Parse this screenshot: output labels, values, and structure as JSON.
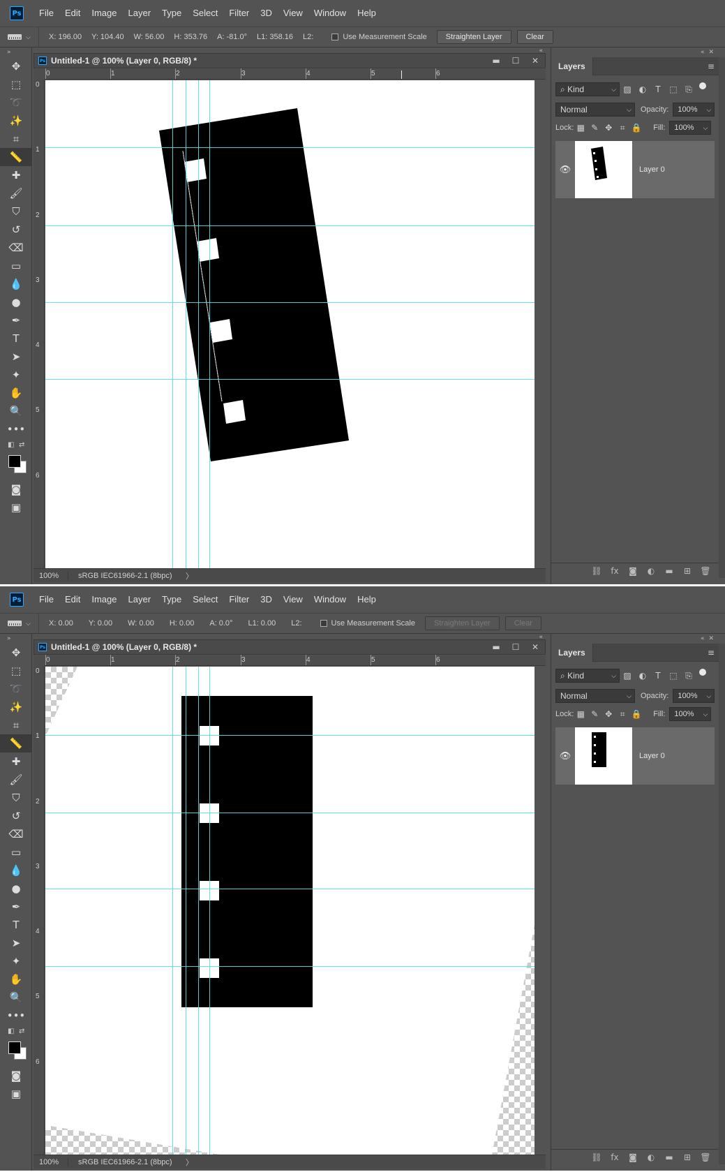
{
  "menu": [
    "File",
    "Edit",
    "Image",
    "Layer",
    "Type",
    "Select",
    "Filter",
    "3D",
    "View",
    "Window",
    "Help"
  ],
  "app_logo": "Ps",
  "screens": [
    {
      "options": {
        "x": "X: 196.00",
        "y": "Y: 104.40",
        "w": "W: 56.00",
        "h": "H: 353.76",
        "a": "A: -81.0°",
        "l1": "L1: 358.16",
        "l2": "L2:",
        "use_scale": "Use Measurement Scale",
        "straighten": "Straighten Layer",
        "clear": "Clear",
        "buttons_enabled": true
      },
      "doc_title": "Untitled-1 @ 100% (Layer 0, RGB/8) *",
      "zoom": "100%",
      "profile": "sRGB IEC61966-2.1 (8bpc)",
      "layer_name": "Layer 0",
      "state": "before"
    },
    {
      "options": {
        "x": "X: 0.00",
        "y": "Y: 0.00",
        "w": "W: 0.00",
        "h": "H: 0.00",
        "a": "A: 0.0°",
        "l1": "L1: 0.00",
        "l2": "L2:",
        "use_scale": "Use Measurement Scale",
        "straighten": "Straighten Layer",
        "clear": "Clear",
        "buttons_enabled": false
      },
      "doc_title": "Untitled-1 @ 100% (Layer 0, RGB/8) *",
      "zoom": "100%",
      "profile": "sRGB IEC61966-2.1 (8bpc)",
      "layer_name": "Layer 0",
      "state": "after"
    }
  ],
  "rulers": {
    "top_labels": [
      "0",
      "1",
      "2",
      "3",
      "4",
      "5",
      "6"
    ],
    "left_labels": [
      "0",
      "1",
      "2",
      "3",
      "4",
      "5",
      "6"
    ]
  },
  "layers_panel": {
    "tab": "Layers",
    "kind": "Kind",
    "blend_mode": "Normal",
    "opacity_label": "Opacity:",
    "opacity": "100%",
    "lock_label": "Lock:",
    "fill_label": "Fill:",
    "fill": "100%"
  },
  "colors": {
    "guide": "#4fe1e6",
    "ui_bg": "#535353",
    "layer_selected": "#6a6a6a"
  }
}
